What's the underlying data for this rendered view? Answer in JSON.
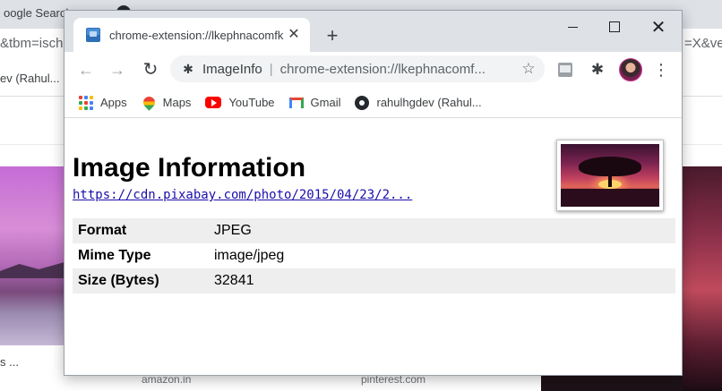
{
  "background": {
    "tab1_title": "oogle Search",
    "tab2_title": "",
    "address_left": "&tbm=isch",
    "address_right": "=X&ve",
    "bookmark_left": "ev (Rahul...",
    "caption_left": "s ...",
    "caption_amazon": "amazon.in",
    "caption_pinterest": "pinterest.com"
  },
  "window": {
    "tab": {
      "title": "chrome-extension://lkephnacomfkn",
      "close_glyph": "✕"
    },
    "new_tab_glyph": "+",
    "controls": {
      "close_glyph": "✕"
    },
    "toolbar": {
      "back_glyph": "←",
      "forward_glyph": "→",
      "reload_glyph": "↻",
      "site_name": "ImageInfo",
      "separator": "|",
      "url": "chrome-extension://lkephnacomf...",
      "star_glyph": "☆",
      "puzzle_glyph": "✱",
      "menu_glyph": "⋮"
    },
    "bookmarks": [
      {
        "label": "Apps",
        "icon": "apps-grid-icon"
      },
      {
        "label": "Maps",
        "icon": "maps-pin-icon"
      },
      {
        "label": "YouTube",
        "icon": "youtube-icon"
      },
      {
        "label": "Gmail",
        "icon": "gmail-icon"
      },
      {
        "label": "rahulhgdev (Rahul...",
        "icon": "github-icon"
      }
    ]
  },
  "page": {
    "title": "Image Information",
    "link": "https://cdn.pixabay.com/photo/2015/04/23/2...",
    "rows": [
      {
        "key": "Format",
        "value": "JPEG"
      },
      {
        "key": "Mime Type",
        "value": "image/jpeg"
      },
      {
        "key": "Size (Bytes)",
        "value": "32841"
      }
    ]
  },
  "colors": {
    "apps_dots": [
      "#ea4335",
      "#4285f4",
      "#fbbc04",
      "#34a853",
      "#ea4335",
      "#4285f4",
      "#fbbc04",
      "#34a853",
      "#4285f4"
    ],
    "link": "#1a0dab",
    "table_stripe": "#eeeeee"
  }
}
